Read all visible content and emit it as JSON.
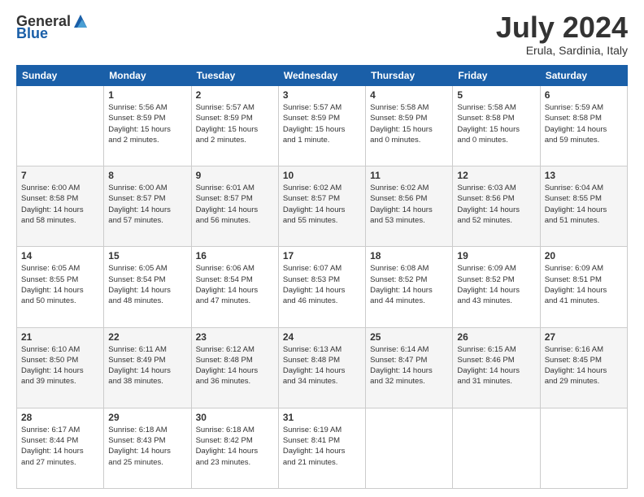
{
  "logo": {
    "general": "General",
    "blue": "Blue"
  },
  "header": {
    "month": "July 2024",
    "location": "Erula, Sardinia, Italy"
  },
  "weekdays": [
    "Sunday",
    "Monday",
    "Tuesday",
    "Wednesday",
    "Thursday",
    "Friday",
    "Saturday"
  ],
  "weeks": [
    [
      {
        "day": "",
        "info": ""
      },
      {
        "day": "1",
        "info": "Sunrise: 5:56 AM\nSunset: 8:59 PM\nDaylight: 15 hours\nand 2 minutes."
      },
      {
        "day": "2",
        "info": "Sunrise: 5:57 AM\nSunset: 8:59 PM\nDaylight: 15 hours\nand 2 minutes."
      },
      {
        "day": "3",
        "info": "Sunrise: 5:57 AM\nSunset: 8:59 PM\nDaylight: 15 hours\nand 1 minute."
      },
      {
        "day": "4",
        "info": "Sunrise: 5:58 AM\nSunset: 8:59 PM\nDaylight: 15 hours\nand 0 minutes."
      },
      {
        "day": "5",
        "info": "Sunrise: 5:58 AM\nSunset: 8:58 PM\nDaylight: 15 hours\nand 0 minutes."
      },
      {
        "day": "6",
        "info": "Sunrise: 5:59 AM\nSunset: 8:58 PM\nDaylight: 14 hours\nand 59 minutes."
      }
    ],
    [
      {
        "day": "7",
        "info": "Sunrise: 6:00 AM\nSunset: 8:58 PM\nDaylight: 14 hours\nand 58 minutes."
      },
      {
        "day": "8",
        "info": "Sunrise: 6:00 AM\nSunset: 8:57 PM\nDaylight: 14 hours\nand 57 minutes."
      },
      {
        "day": "9",
        "info": "Sunrise: 6:01 AM\nSunset: 8:57 PM\nDaylight: 14 hours\nand 56 minutes."
      },
      {
        "day": "10",
        "info": "Sunrise: 6:02 AM\nSunset: 8:57 PM\nDaylight: 14 hours\nand 55 minutes."
      },
      {
        "day": "11",
        "info": "Sunrise: 6:02 AM\nSunset: 8:56 PM\nDaylight: 14 hours\nand 53 minutes."
      },
      {
        "day": "12",
        "info": "Sunrise: 6:03 AM\nSunset: 8:56 PM\nDaylight: 14 hours\nand 52 minutes."
      },
      {
        "day": "13",
        "info": "Sunrise: 6:04 AM\nSunset: 8:55 PM\nDaylight: 14 hours\nand 51 minutes."
      }
    ],
    [
      {
        "day": "14",
        "info": "Sunrise: 6:05 AM\nSunset: 8:55 PM\nDaylight: 14 hours\nand 50 minutes."
      },
      {
        "day": "15",
        "info": "Sunrise: 6:05 AM\nSunset: 8:54 PM\nDaylight: 14 hours\nand 48 minutes."
      },
      {
        "day": "16",
        "info": "Sunrise: 6:06 AM\nSunset: 8:54 PM\nDaylight: 14 hours\nand 47 minutes."
      },
      {
        "day": "17",
        "info": "Sunrise: 6:07 AM\nSunset: 8:53 PM\nDaylight: 14 hours\nand 46 minutes."
      },
      {
        "day": "18",
        "info": "Sunrise: 6:08 AM\nSunset: 8:52 PM\nDaylight: 14 hours\nand 44 minutes."
      },
      {
        "day": "19",
        "info": "Sunrise: 6:09 AM\nSunset: 8:52 PM\nDaylight: 14 hours\nand 43 minutes."
      },
      {
        "day": "20",
        "info": "Sunrise: 6:09 AM\nSunset: 8:51 PM\nDaylight: 14 hours\nand 41 minutes."
      }
    ],
    [
      {
        "day": "21",
        "info": "Sunrise: 6:10 AM\nSunset: 8:50 PM\nDaylight: 14 hours\nand 39 minutes."
      },
      {
        "day": "22",
        "info": "Sunrise: 6:11 AM\nSunset: 8:49 PM\nDaylight: 14 hours\nand 38 minutes."
      },
      {
        "day": "23",
        "info": "Sunrise: 6:12 AM\nSunset: 8:48 PM\nDaylight: 14 hours\nand 36 minutes."
      },
      {
        "day": "24",
        "info": "Sunrise: 6:13 AM\nSunset: 8:48 PM\nDaylight: 14 hours\nand 34 minutes."
      },
      {
        "day": "25",
        "info": "Sunrise: 6:14 AM\nSunset: 8:47 PM\nDaylight: 14 hours\nand 32 minutes."
      },
      {
        "day": "26",
        "info": "Sunrise: 6:15 AM\nSunset: 8:46 PM\nDaylight: 14 hours\nand 31 minutes."
      },
      {
        "day": "27",
        "info": "Sunrise: 6:16 AM\nSunset: 8:45 PM\nDaylight: 14 hours\nand 29 minutes."
      }
    ],
    [
      {
        "day": "28",
        "info": "Sunrise: 6:17 AM\nSunset: 8:44 PM\nDaylight: 14 hours\nand 27 minutes."
      },
      {
        "day": "29",
        "info": "Sunrise: 6:18 AM\nSunset: 8:43 PM\nDaylight: 14 hours\nand 25 minutes."
      },
      {
        "day": "30",
        "info": "Sunrise: 6:18 AM\nSunset: 8:42 PM\nDaylight: 14 hours\nand 23 minutes."
      },
      {
        "day": "31",
        "info": "Sunrise: 6:19 AM\nSunset: 8:41 PM\nDaylight: 14 hours\nand 21 minutes."
      },
      {
        "day": "",
        "info": ""
      },
      {
        "day": "",
        "info": ""
      },
      {
        "day": "",
        "info": ""
      }
    ]
  ]
}
